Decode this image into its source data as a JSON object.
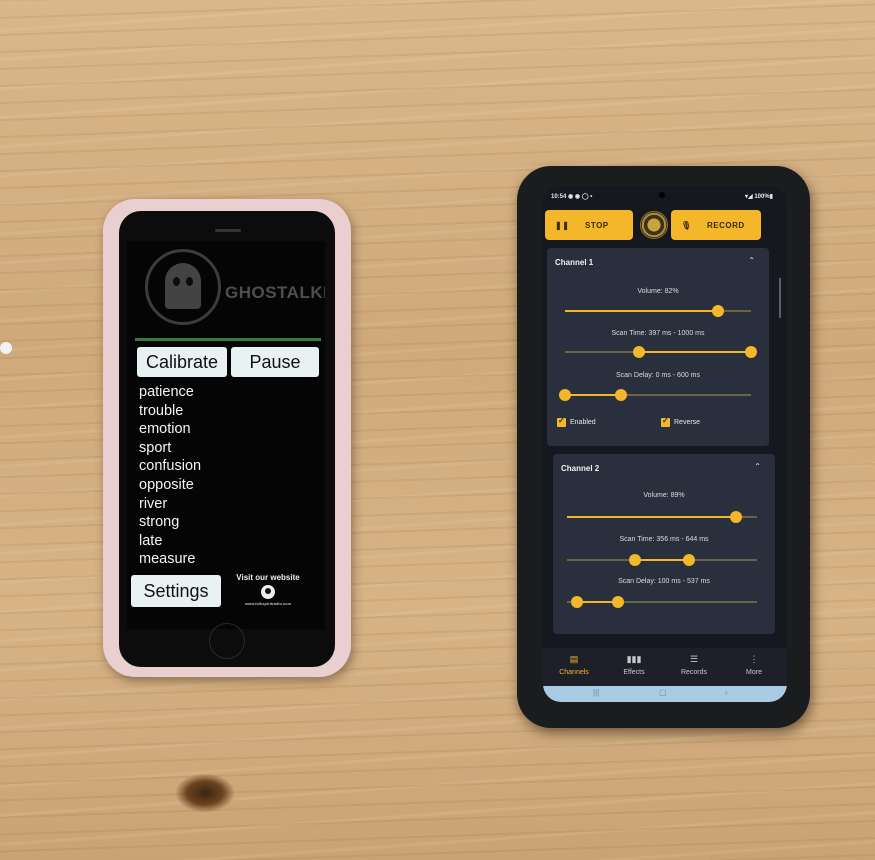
{
  "left_phone": {
    "brand": "GHOSTALKER",
    "buttons": {
      "calibrate": "Calibrate",
      "pause": "Pause",
      "settings": "Settings"
    },
    "words": [
      "patience",
      "trouble",
      "emotion",
      "sport",
      "confusion",
      "opposite",
      "river",
      "strong",
      "late",
      "measure"
    ],
    "visit_text": "Visit our website",
    "visit_small": "www.folkspiritradio.com"
  },
  "right_phone": {
    "status": {
      "time": "10:54 ◉ ◉ ◯ •",
      "battery": "▾◢ 100%▮"
    },
    "top_bar": {
      "stop": "STOP",
      "stop_icon": "❚❚",
      "record": "RECORD",
      "record_icon": "🎙"
    },
    "channels": [
      {
        "title": "Channel 1",
        "volume_label": "Volume: 82%",
        "volume": 0.82,
        "scan_time_label": "Scan Time: 397 ms - 1000 ms",
        "scan_time": [
          0.397,
          1.0
        ],
        "scan_delay_label": "Scan Delay: 0 ms - 600 ms",
        "scan_delay": [
          0.0,
          0.3
        ],
        "enabled_label": "Enabled",
        "reverse_label": "Reverse"
      },
      {
        "title": "Channel 2",
        "volume_label": "Volume: 89%",
        "volume": 0.89,
        "scan_time_label": "Scan Time: 356 ms - 644 ms",
        "scan_time": [
          0.356,
          0.644
        ],
        "scan_delay_label": "Scan Delay: 100 ms - 537 ms",
        "scan_delay": [
          0.05,
          0.268
        ]
      }
    ],
    "nav": [
      {
        "label": "Channels",
        "icon": "▤",
        "active": true
      },
      {
        "label": "Effects",
        "icon": "▮▮▮",
        "active": false
      },
      {
        "label": "Records",
        "icon": "☰",
        "active": false
      },
      {
        "label": "More",
        "icon": "⋮",
        "active": false
      }
    ],
    "system": {
      "recents": "|||",
      "home": "▢",
      "back": "‹"
    },
    "accent": "#f5b72a"
  }
}
